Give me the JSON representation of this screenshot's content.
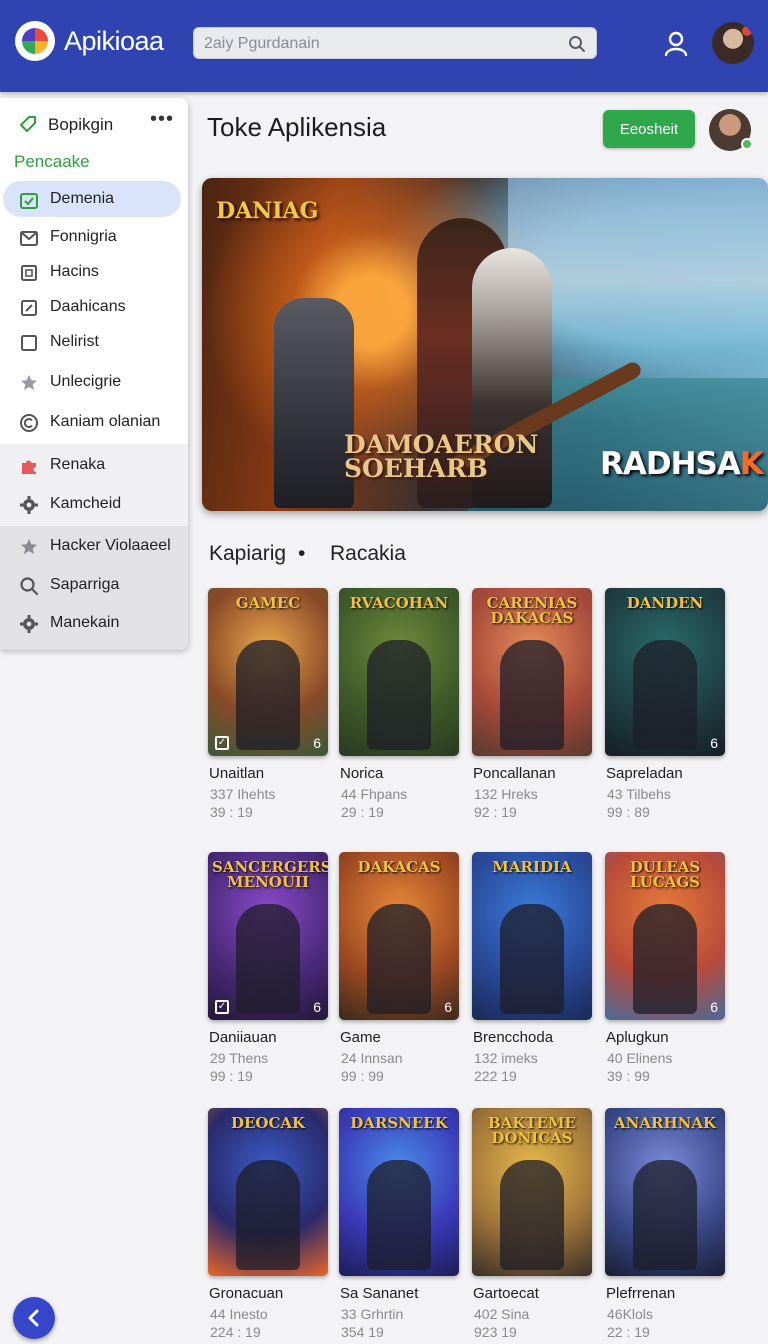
{
  "app": {
    "title": "Apikioaa",
    "search_placeholder": "2aiy Pgurdanain"
  },
  "sidebar": {
    "header_label": "Bopikgin",
    "more_glyph": "•••",
    "section_label": "Pencaake",
    "items": [
      {
        "label": "Demenia",
        "icon": "calendar-check-icon",
        "active": true
      },
      {
        "label": "Fonnigria",
        "icon": "mail-icon"
      },
      {
        "label": "Hacins",
        "icon": "square-icon"
      },
      {
        "label": "Daahicans",
        "icon": "edit-icon"
      },
      {
        "label": "Nelirist",
        "icon": "checkbox-icon"
      },
      {
        "label": "Unlecigrie",
        "icon": "star-icon"
      },
      {
        "label": "Kaniam olanian",
        "icon": "copyright-icon"
      },
      {
        "label": "Renaka",
        "icon": "puzzle-icon"
      },
      {
        "label": "Kamcheid",
        "icon": "gear-icon"
      },
      {
        "label": "Hacker Violaaeel",
        "icon": "star-icon"
      },
      {
        "label": "Saparriga",
        "icon": "search-icon"
      },
      {
        "label": "Manekain",
        "icon": "gear-icon"
      }
    ]
  },
  "main": {
    "page_title": "Toke Aplikensia",
    "primary_button": "Eeosheit",
    "banner": {
      "title_top_left": "DANIAG",
      "title_bottom": "DAMOAERON SOEHARB",
      "title_bottom_right": "RADHSA",
      "title_bottom_right_accent": "K"
    },
    "tabs": [
      "Kapiarig",
      "Racakia"
    ],
    "tab_separator": "•",
    "cards": [
      {
        "cover_title": "GAMEC",
        "name": "Unaitlan",
        "meta1": "337 Ihehts",
        "meta2": "39 : 19",
        "checkbox": "✓",
        "badge": "6",
        "colors": [
          "#e6a44a",
          "#8a4a28",
          "#3b5a3a"
        ]
      },
      {
        "cover_title": "RVACOHAN",
        "name": "Norica",
        "meta1": "44 Fhpans",
        "meta2": "29 : 19",
        "checkbox": "",
        "badge": "",
        "colors": [
          "#6f8a3a",
          "#3f5a2a",
          "#2a3a20"
        ]
      },
      {
        "cover_title": "CARENIAS DAKACAS",
        "name": "Poncallanan",
        "meta1": "132 Hreks",
        "meta2": "92 : 19",
        "checkbox": "",
        "badge": "",
        "colors": [
          "#e28a5a",
          "#a84a3a",
          "#5a3a30"
        ]
      },
      {
        "cover_title": "DANDEN",
        "name": "Sapreladan",
        "meta1": "43 Tilbehs",
        "meta2": "99 : 89",
        "checkbox": "",
        "badge": "6",
        "colors": [
          "#2a6a6a",
          "#1f3f44",
          "#151f25"
        ]
      },
      {
        "cover_title": "SANCERGERS MENOUII",
        "name": "Daniiauan",
        "meta1": "29 Thens",
        "meta2": "99 : 19",
        "checkbox": "✓",
        "badge": "6",
        "colors": [
          "#8a4ac8",
          "#4a2a7a",
          "#241838"
        ]
      },
      {
        "cover_title": "DAKACAS",
        "name": "Game",
        "meta1": "24 Innsan",
        "meta2": "99 : 99",
        "checkbox": "",
        "badge": "6",
        "colors": [
          "#e6883a",
          "#a04a22",
          "#3a2a1e"
        ]
      },
      {
        "cover_title": "MARIDIA",
        "name": "Brencchoda",
        "meta1": "132 imeks",
        "meta2": "222 19",
        "checkbox": "",
        "badge": "",
        "colors": [
          "#3a7ad8",
          "#2a4a9a",
          "#1a2a58"
        ]
      },
      {
        "cover_title": "DULEAS LUCAGS",
        "name": "Aplugkun",
        "meta1": "40 Elinens",
        "meta2": "39 : 99",
        "checkbox": "",
        "badge": "6",
        "colors": [
          "#e67a3a",
          "#b84a3a",
          "#4a6a9a"
        ]
      },
      {
        "cover_title": "DEOCAK",
        "name": "Gronacuan",
        "meta1": "44 Inesto",
        "meta2": "224 : 19",
        "checkbox": "",
        "badge": "",
        "colors": [
          "#3a5ac8",
          "#2a2a6a",
          "#e8662a"
        ]
      },
      {
        "cover_title": "DARSNEEK",
        "name": "Sa Sananet",
        "meta1": "33 Grhrtin",
        "meta2": "354 19",
        "checkbox": "",
        "badge": "",
        "colors": [
          "#4a8ae8",
          "#3a3ab8",
          "#1e1e58"
        ]
      },
      {
        "cover_title": "BAKTEME DONICAS",
        "name": "Gartoecat",
        "meta1": "402 Sina",
        "meta2": "923 19",
        "checkbox": "",
        "badge": "",
        "colors": [
          "#e6b84a",
          "#a0743a",
          "#3a3028"
        ]
      },
      {
        "cover_title": "ANARHNAK",
        "name": "Plefrrenan",
        "meta1": "46Klols",
        "meta2": "22 : 19",
        "checkbox": "",
        "badge": "",
        "colors": [
          "#7a8ad8",
          "#3a4a8a",
          "#1a1e38"
        ]
      }
    ]
  },
  "theme": {
    "topbar": "#2f44b0",
    "accent_green": "#2ea84a",
    "active_item_bg": "#d9e3fa"
  }
}
